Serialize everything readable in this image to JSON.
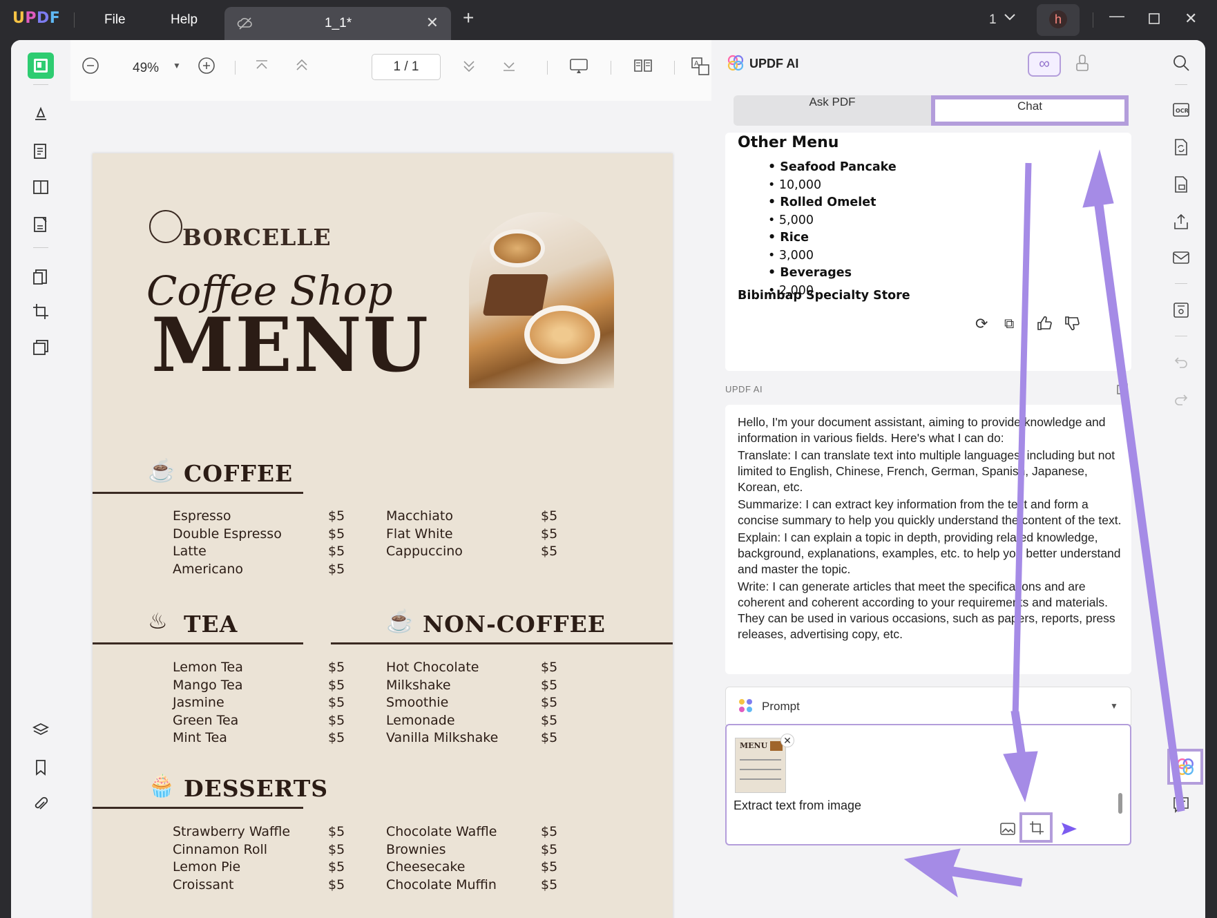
{
  "titlebar": {
    "logo": {
      "u": "U",
      "p": "P",
      "d": "D",
      "f": "F"
    },
    "menu": {
      "file": "File",
      "help": "Help"
    },
    "tab_name": "1_1*",
    "page_count_indicator": "1",
    "avatar_letter": "h"
  },
  "toolbar": {
    "zoom": "49%",
    "page_indicator": "1  /  1"
  },
  "document": {
    "brand": "BORCELLE",
    "script_title": "Coffee Shop",
    "big_title": "MENU",
    "sections": {
      "coffee": {
        "title": "COFFEE",
        "left": [
          [
            "Espresso",
            "$5"
          ],
          [
            "Double Espresso",
            "$5"
          ],
          [
            "Latte",
            "$5"
          ],
          [
            "Americano",
            "$5"
          ]
        ],
        "right": [
          [
            "Macchiato",
            "$5"
          ],
          [
            "Flat White",
            "$5"
          ],
          [
            "Cappuccino",
            "$5"
          ]
        ]
      },
      "tea": {
        "title": "TEA",
        "items": [
          [
            "Lemon Tea",
            "$5"
          ],
          [
            "Mango Tea",
            "$5"
          ],
          [
            "Jasmine",
            "$5"
          ],
          [
            "Green Tea",
            "$5"
          ],
          [
            "Mint Tea",
            "$5"
          ]
        ]
      },
      "noncoffee": {
        "title": "NON-COFFEE",
        "items": [
          [
            "Hot Chocolate",
            "$5"
          ],
          [
            "Milkshake",
            "$5"
          ],
          [
            "Smoothie",
            "$5"
          ],
          [
            "Lemonade",
            "$5"
          ],
          [
            "Vanilla Milkshake",
            "$5"
          ]
        ]
      },
      "desserts": {
        "title": "DESSERTS",
        "left": [
          [
            "Strawberry Waffle",
            "$5"
          ],
          [
            "Cinnamon Roll",
            "$5"
          ],
          [
            "Lemon Pie",
            "$5"
          ],
          [
            "Croissant",
            "$5"
          ]
        ],
        "right": [
          [
            "Chocolate Waffle",
            "$5"
          ],
          [
            "Brownies",
            "$5"
          ],
          [
            "Cheesecake",
            "$5"
          ],
          [
            "Chocolate Muffin",
            "$5"
          ]
        ]
      }
    }
  },
  "ai_panel": {
    "title": "UPDF AI",
    "tabs": {
      "ask": "Ask PDF",
      "chat": "Chat"
    },
    "response": {
      "heading": "Other Menu",
      "items": [
        {
          "text": "Seafood Pancake",
          "bold": true
        },
        {
          "text": "10,000",
          "bold": false
        },
        {
          "text": "Rolled Omelet",
          "bold": true
        },
        {
          "text": "5,000",
          "bold": false
        },
        {
          "text": "Rice",
          "bold": true
        },
        {
          "text": "3,000",
          "bold": false
        },
        {
          "text": "Beverages",
          "bold": true
        },
        {
          "text": "2,000",
          "bold": false
        }
      ],
      "store": "Bibimbap Specialty Store"
    },
    "label": "UPDF AI",
    "intro": [
      "Hello, I'm your document assistant, aiming to provide knowledge and information in various fields. Here's what I can do:",
      "Translate: I can translate text into multiple languages, including but not limited to English, Chinese, French, German, Spanish, Japanese, Korean, etc.",
      "Summarize: I can extract key information from the text and form a concise summary to help you quickly understand the content of the text.",
      "Explain: I can explain a topic in depth, providing related knowledge, background, explanations, examples, etc. to help you better understand and master the topic.",
      "Write: I can generate articles that meet the specifications and are coherent and coherent according to your requirements and materials. They can be used in various occasions, such as papers, reports, press releases, advertising copy, etc."
    ],
    "prompt_label": "Prompt",
    "input_text": "Extract text from image",
    "thumb_text": "MENU"
  },
  "colors": {
    "accent": "#b39ddb",
    "active_tool": "#2ecc71",
    "send": "#7c5cf0",
    "arrow": "#a58be6"
  }
}
